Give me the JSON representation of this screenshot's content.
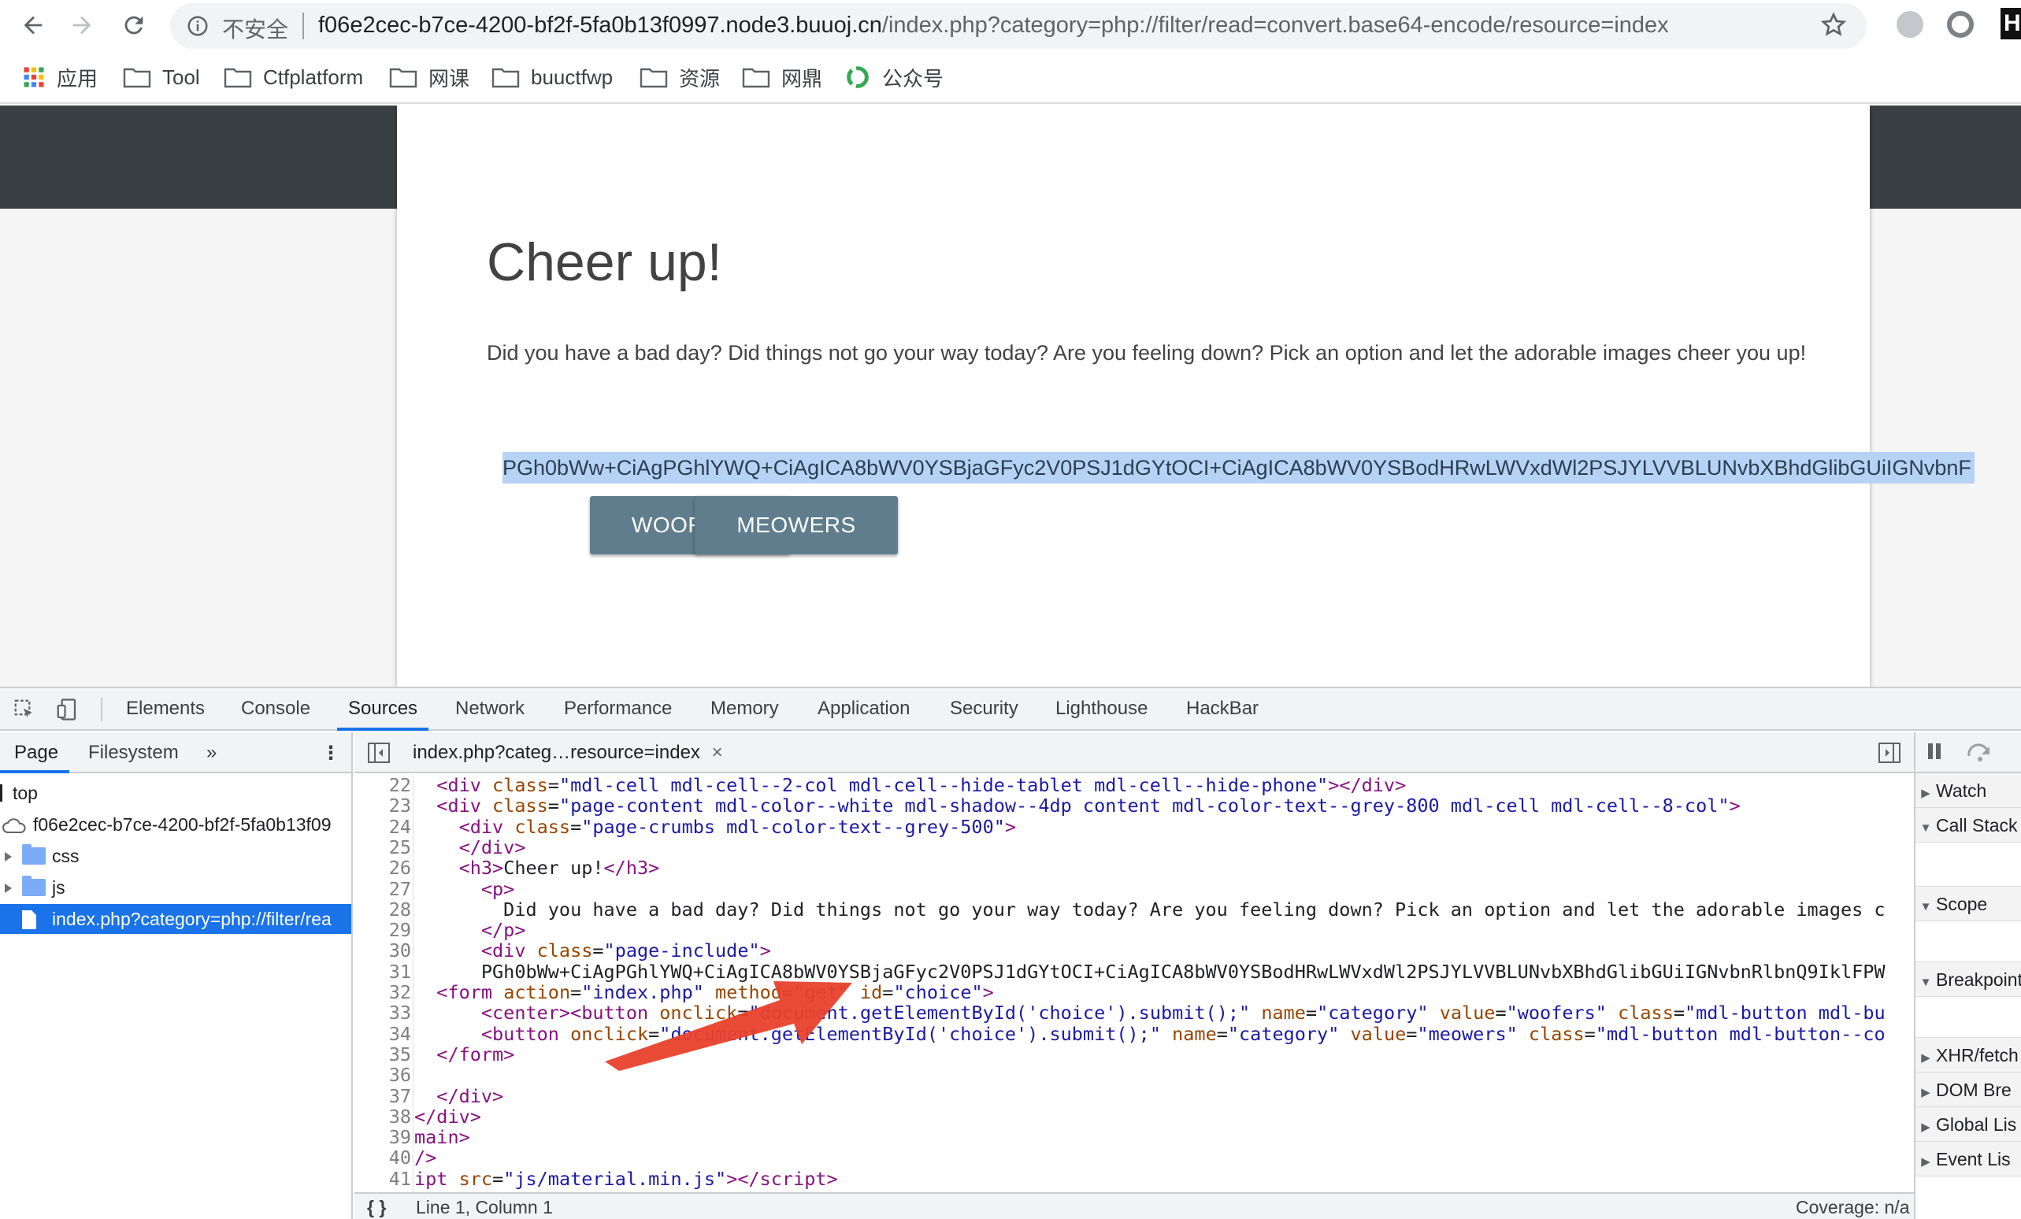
{
  "browser": {
    "insecure_label": "不安全",
    "url_host": "f06e2cec-b7ce-4200-bf2f-5fa0b13f0997.node3.buuoj.cn",
    "url_path": "/index.php?category=php://filter/read=convert.base64-encode/resource=index"
  },
  "bookmarks": [
    {
      "label": "应用",
      "icon": "apps-grid-icon"
    },
    {
      "label": "Tool",
      "icon": "folder-icon"
    },
    {
      "label": "Ctfplatform",
      "icon": "folder-icon"
    },
    {
      "label": "网课",
      "icon": "folder-icon"
    },
    {
      "label": "buuctfwp",
      "icon": "folder-icon"
    },
    {
      "label": "资源",
      "icon": "folder-icon"
    },
    {
      "label": "网鼎",
      "icon": "folder-icon"
    },
    {
      "label": "公众号",
      "icon": "wechat-icon"
    }
  ],
  "page": {
    "title": "Cheer up!",
    "paragraph": "Did you have a bad day? Did things not go your way today? Are you feeling down? Pick an option and let the adorable images cheer you up!",
    "base64_text": "PGh0bWw+CiAgPGhlYWQ+CiAgICA8bWV0YSBjaGFyc2V0PSJ1dGYtOCI+CiAgICA8bWV0YSBodHRwLWVxdWl2PSJYLVVBLUNvbXBhdGlibGUiIGNvbnF",
    "buttons": {
      "woofers": "WOOFERS",
      "meowers": "MEOWERS"
    }
  },
  "devtools": {
    "tabs": [
      "Elements",
      "Console",
      "Sources",
      "Network",
      "Performance",
      "Memory",
      "Application",
      "Security",
      "Lighthouse",
      "HackBar"
    ],
    "active_tab": "Sources",
    "navigator": {
      "subtabs": [
        "Page",
        "Filesystem"
      ],
      "more": "»",
      "tree": {
        "top": "top",
        "domain": "f06e2cec-b7ce-4200-bf2f-5fa0b13f09",
        "css": "css",
        "js": "js",
        "file": "index.php?category=php://filter/rea"
      }
    },
    "editor": {
      "file_tab": "index.php?categ…resource=index",
      "close": "×",
      "status_position": "Line 1, Column 1",
      "status_coverage": "Coverage: n/a",
      "lines": [
        {
          "n": "22",
          "html": "  <span class=\"tg\">&lt;div</span> <span class=\"at\">class</span>=<span class=\"av\">\"mdl-cell mdl-cell--2-col mdl-cell--hide-tablet mdl-cell--hide-phone\"</span><span class=\"tg\">&gt;&lt;/div&gt;</span>"
        },
        {
          "n": "23",
          "html": "  <span class=\"tg\">&lt;div</span> <span class=\"at\">class</span>=<span class=\"av\">\"page-content mdl-color--white mdl-shadow--4dp content mdl-color-text--grey-800 mdl-cell mdl-cell--8-col\"</span><span class=\"tg\">&gt;</span>"
        },
        {
          "n": "24",
          "html": "    <span class=\"tg\">&lt;div</span> <span class=\"at\">class</span>=<span class=\"av\">\"page-crumbs mdl-color-text--grey-500\"</span><span class=\"tg\">&gt;</span>"
        },
        {
          "n": "25",
          "html": "    <span class=\"tg\">&lt;/div&gt;</span>"
        },
        {
          "n": "26",
          "html": "    <span class=\"tg\">&lt;h3&gt;</span>Cheer up!<span class=\"tg\">&lt;/h3&gt;</span>"
        },
        {
          "n": "27",
          "html": "      <span class=\"tg\">&lt;p&gt;</span>"
        },
        {
          "n": "28",
          "html": "        Did you have a bad day? Did things not go your way today? Are you feeling down? Pick an option and let the adorable images c"
        },
        {
          "n": "29",
          "html": "      <span class=\"tg\">&lt;/p&gt;</span>"
        },
        {
          "n": "30",
          "html": "      <span class=\"tg\">&lt;div</span> <span class=\"at\">class</span>=<span class=\"av\">\"page-include\"</span><span class=\"tg\">&gt;</span>"
        },
        {
          "n": "31",
          "html": "      PGh0bWw+CiAgPGhlYWQ+CiAgICA8bWV0YSBjaGFyc2V0PSJ1dGYtOCI+CiAgICA8bWV0YSBodHRwLWVxdWl2PSJYLVVBLUNvbXBhdGlibGUiIGNvbnRlbnQ9IklFPW"
        },
        {
          "n": "32",
          "html": "  <span class=\"tg\">&lt;form</span> <span class=\"at\">action</span>=<span class=\"av\">\"index.php\"</span> <span class=\"at\">method</span>=<span class=\"av\">\"get\"</span> <span class=\"at\">id</span>=<span class=\"av\">\"choice\"</span><span class=\"tg\">&gt;</span>"
        },
        {
          "n": "33",
          "html": "      <span class=\"tg\">&lt;center&gt;&lt;button</span> <span class=\"at\">onclick</span>=<span class=\"av\">\"document.getElementById('choice').submit();\"</span> <span class=\"at\">name</span>=<span class=\"av\">\"category\"</span> <span class=\"at\">value</span>=<span class=\"av\">\"woofers\"</span> <span class=\"at\">class</span>=<span class=\"av\">\"mdl-button mdl-bu</span>"
        },
        {
          "n": "34",
          "html": "      <span class=\"tg\">&lt;button</span> <span class=\"at\">onclick</span>=<span class=\"av\">\"document.getElementById('choice').submit();\"</span> <span class=\"at\">name</span>=<span class=\"av\">\"category\"</span> <span class=\"at\">value</span>=<span class=\"av\">\"meowers\"</span> <span class=\"at\">class</span>=<span class=\"av\">\"mdl-button mdl-button--co</span>"
        },
        {
          "n": "35",
          "html": "  <span class=\"tg\">&lt;/form&gt;</span>"
        },
        {
          "n": "36",
          "html": ""
        },
        {
          "n": "37",
          "html": "  <span class=\"tg\">&lt;/div&gt;</span>"
        },
        {
          "n": "38",
          "html": "<span class=\"tg\">&lt;/div&gt;</span>"
        },
        {
          "n": "39",
          "html": "<span class=\"tg\">main&gt;</span>"
        },
        {
          "n": "40",
          "html": "<span class=\"tg\">/&gt;</span>"
        },
        {
          "n": "41",
          "html": "<span class=\"tg\">ipt</span> <span class=\"at\">src</span>=<span class=\"av\">\"js/material.min.js\"</span><span class=\"tg\">&gt;&lt;/script&gt;</span>"
        }
      ]
    },
    "debugger": {
      "sections": [
        "Watch",
        "Call Stack",
        "Scope",
        "Breakpoints",
        "XHR/fetch",
        "DOM Bre",
        "Global Lis",
        "Event Lis"
      ]
    }
  },
  "colors": {
    "accent": "#1a73e8",
    "button": "#5f7d8c",
    "header_band": "#3a3f44",
    "selection": "#b6d2f5",
    "arrow": "#e8412c"
  }
}
